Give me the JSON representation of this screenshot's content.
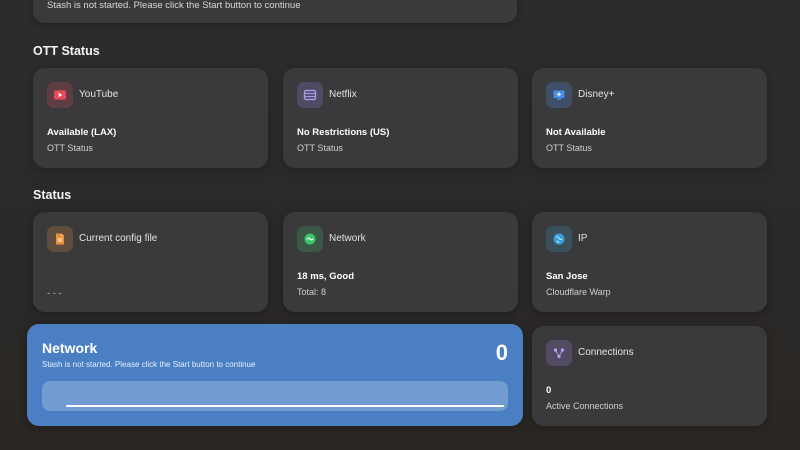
{
  "top_notice": "Stash is not started. Please click the Start button to continue",
  "sections": {
    "ott_title": "OTT Status",
    "status_title": "Status"
  },
  "ott": [
    {
      "name": "YouTube",
      "value": "Available (LAX)",
      "sub": "OTT Status",
      "icon": "youtube-icon",
      "color": "#e94a5a"
    },
    {
      "name": "Netflix",
      "value": "No Restrictions (US)",
      "sub": "OTT Status",
      "icon": "netflix-icon",
      "color": "#8e7fd6"
    },
    {
      "name": "Disney+",
      "value": "Not Available",
      "sub": "OTT Status",
      "icon": "disney-plus-icon",
      "color": "#4b8ee8"
    }
  ],
  "status": [
    {
      "name": "Current config file",
      "value": "- - -",
      "sub": "",
      "icon": "file-icon",
      "color": "#e8923a"
    },
    {
      "name": "Network",
      "value": "18 ms, Good",
      "sub": "Total: 8",
      "icon": "network-icon",
      "color": "#3ec46d"
    },
    {
      "name": "IP",
      "value": "San Jose",
      "sub": "Cloudflare Warp",
      "icon": "globe-icon",
      "color": "#3aa0d8"
    }
  ],
  "network_card": {
    "title": "Network",
    "message": "Stash is not started. Please click the Start button to continue",
    "count": "0",
    "progress": 1.0
  },
  "connections": {
    "name": "Connections",
    "value": "0",
    "sub": "Active Connections",
    "icon": "connections-icon",
    "color": "#9b7fd6"
  }
}
